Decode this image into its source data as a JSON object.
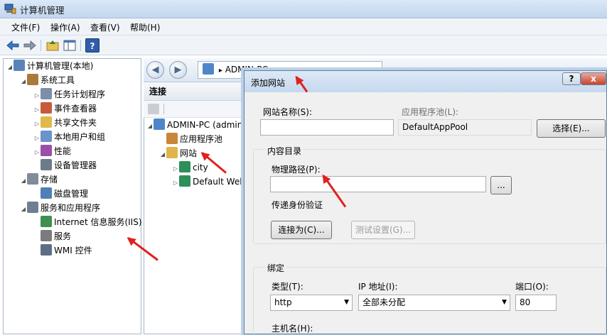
{
  "window": {
    "title": "计算机管理"
  },
  "menu": [
    "文件(F)",
    "操作(A)",
    "查看(V)",
    "帮助(H)"
  ],
  "toolbar": {
    "help_label": "?"
  },
  "tree": [
    {
      "label": "计算机管理(本地)",
      "level": 0,
      "expand": "expanded",
      "icon": "computer-icon"
    },
    {
      "label": "系统工具",
      "level": 1,
      "expand": "expanded",
      "icon": "tools-icon"
    },
    {
      "label": "任务计划程序",
      "level": 2,
      "expand": "collapsed",
      "icon": "clock-icon"
    },
    {
      "label": "事件查看器",
      "level": 2,
      "expand": "collapsed",
      "icon": "event-icon"
    },
    {
      "label": "共享文件夹",
      "level": 2,
      "expand": "collapsed",
      "icon": "folder-share-icon"
    },
    {
      "label": "本地用户和组",
      "level": 2,
      "expand": "collapsed",
      "icon": "users-icon"
    },
    {
      "label": "性能",
      "level": 2,
      "expand": "collapsed",
      "icon": "performance-icon"
    },
    {
      "label": "设备管理器",
      "level": 2,
      "expand": "none",
      "icon": "device-icon"
    },
    {
      "label": "存储",
      "level": 1,
      "expand": "expanded",
      "icon": "storage-icon"
    },
    {
      "label": "磁盘管理",
      "level": 2,
      "expand": "none",
      "icon": "disk-icon"
    },
    {
      "label": "服务和应用程序",
      "level": 1,
      "expand": "expanded",
      "icon": "services-icon"
    },
    {
      "label": "Internet 信息服务(IIS)管",
      "level": 2,
      "expand": "none",
      "icon": "iis-icon"
    },
    {
      "label": "服务",
      "level": 2,
      "expand": "none",
      "icon": "gear-icon"
    },
    {
      "label": "WMI 控件",
      "level": 2,
      "expand": "none",
      "icon": "wmi-icon"
    }
  ],
  "address": {
    "path": "ADMIN-PC",
    "sep": "▸"
  },
  "connections": {
    "header": "连接",
    "items": [
      {
        "label": "ADMIN-PC (admin",
        "level": 0,
        "expand": "expanded",
        "icon": "server-icon"
      },
      {
        "label": "应用程序池",
        "level": 1,
        "expand": "none",
        "icon": "app-pool-icon"
      },
      {
        "label": "网站",
        "level": 1,
        "expand": "expanded",
        "icon": "sites-folder-icon"
      },
      {
        "label": "city",
        "level": 2,
        "expand": "collapsed",
        "icon": "globe-icon"
      },
      {
        "label": "Default Web",
        "level": 2,
        "expand": "collapsed",
        "icon": "globe-icon"
      }
    ]
  },
  "dialog": {
    "title": "添加网站",
    "help_label": "?",
    "close_label": "x",
    "site_name_label": "网站名称(S):",
    "site_name_value": "",
    "app_pool_label": "应用程序池(L):",
    "app_pool_value": "DefaultAppPool",
    "select_button": "选择(E)...",
    "content_dir_title": "内容目录",
    "physical_path_label": "物理路径(P):",
    "physical_path_value": "",
    "browse_button": "...",
    "pass_auth_label": "传递身份验证",
    "connect_as_button": "连接为(C)...",
    "test_settings_button": "测试设置(G)...",
    "binding_title": "绑定",
    "type_label": "类型(T):",
    "type_value": "http",
    "ip_label": "IP 地址(I):",
    "ip_value": "全部未分配",
    "port_label": "端口(O):",
    "port_value": "80",
    "host_label": "主机名(H):"
  },
  "colors": {
    "annotation_arrow": "#e02020",
    "title_bg": "#c5d8ee"
  }
}
